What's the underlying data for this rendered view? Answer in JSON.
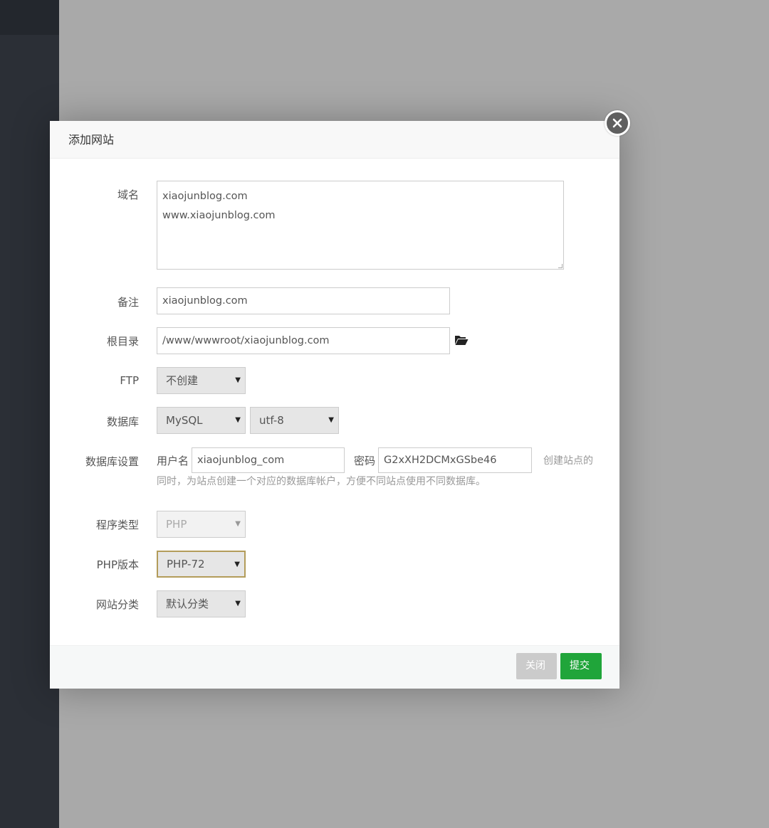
{
  "dialog": {
    "title": "添加网站"
  },
  "form": {
    "domain": {
      "label": "域名",
      "lines": [
        "xiaojunblog.com",
        "www.xiaojunblog.com"
      ]
    },
    "note": {
      "label": "备注",
      "value": "xiaojunblog.com"
    },
    "root": {
      "label": "根目录",
      "value": "/www/wwwroot/xiaojunblog.com"
    },
    "ftp": {
      "label": "FTP",
      "selected": "不创建"
    },
    "database": {
      "label": "数据库",
      "type_selected": "MySQL",
      "charset_selected": "utf-8"
    },
    "db_settings": {
      "label": "数据库设置",
      "username_label": "用户名",
      "username_value": "xiaojunblog_com",
      "password_label": "密码",
      "password_value": "G2xXH2DCMxGSbe46",
      "hint_line1": "创建站点的",
      "hint_line2": "同时，为站点创建一个对应的数据库帐户，方便不同站点使用不同数据库。"
    },
    "program_type": {
      "label": "程序类型",
      "selected": "PHP"
    },
    "php_version": {
      "label": "PHP版本",
      "selected": "PHP-72"
    },
    "site_category": {
      "label": "网站分类",
      "selected": "默认分类"
    }
  },
  "footer": {
    "close_label": "关闭",
    "submit_label": "提交"
  },
  "icons": {
    "close": "close-icon",
    "folder": "folder-open-icon",
    "dropdown": "caret-down-icon"
  },
  "colors": {
    "submit": "#20a53a",
    "close_button": "#cbcbcb",
    "sidebar": "#2b2f36"
  }
}
